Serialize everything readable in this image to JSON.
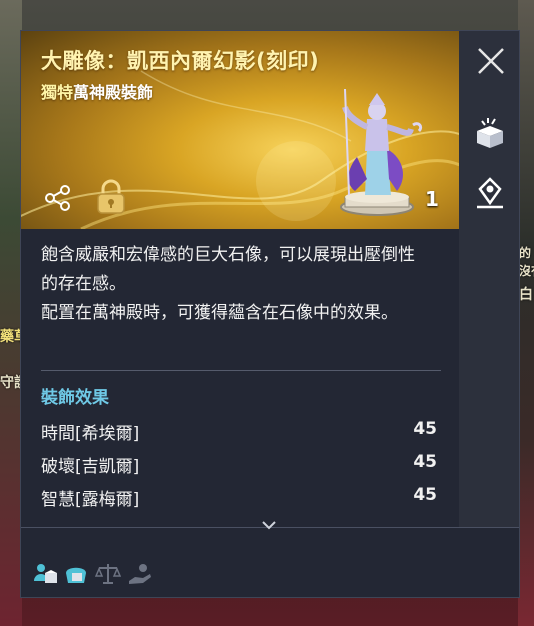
{
  "item": {
    "title": "大雕像：凱西內爾幻影(刻印)",
    "rarity": "獨特",
    "category": "萬神殿裝飾",
    "quantity": "1"
  },
  "description": {
    "line1": "飽含威嚴和宏偉感的巨大石像，可以展現出壓倒性的存在感。",
    "line2": "配置在萬神殿時，可獲得蘊含在石像中的效果。"
  },
  "effects": {
    "title": "裝飾效果",
    "rows": [
      {
        "name": "時間[希埃爾]",
        "value": "45"
      },
      {
        "name": "破壞[吉凱爾]",
        "value": "45"
      },
      {
        "name": "智慧[露梅爾]",
        "value": "45"
      }
    ]
  },
  "background_peek": {
    "left1": "藥草",
    "left2": "守護",
    "right1": "的",
    "right2": "沒有",
    "right3": "白"
  },
  "icons": {
    "close": "close-icon",
    "share": "share-icon",
    "lock": "lock-icon",
    "box": "gift-box-icon",
    "marker": "map-marker-icon",
    "footer": [
      "user-box-icon",
      "bag-icon",
      "scale-icon",
      "hand-coin-icon"
    ]
  },
  "colors": {
    "header_gold": "#d9a524",
    "title": "#fff3b0",
    "section_title": "#6fc9e6",
    "panel_bg": "#232734"
  }
}
